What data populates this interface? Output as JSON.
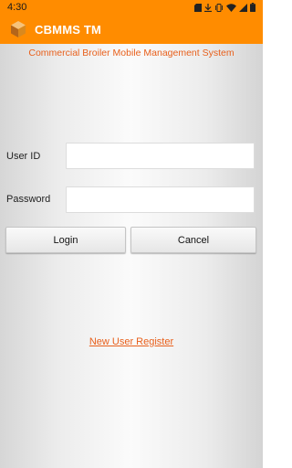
{
  "status_bar": {
    "time": "4:30",
    "icons": [
      "sim-icon",
      "download-icon",
      "vibrate-icon",
      "wifi-icon",
      "signal-icon",
      "battery-icon"
    ]
  },
  "app_bar": {
    "title": "CBMMS TM",
    "logo_icon": "cube-logo-icon",
    "color": "#ff8c00"
  },
  "subtitle": "Commercial Broiler Mobile Management System",
  "form": {
    "user_id_label": "User ID",
    "user_id_value": "",
    "password_label": "Password",
    "password_value": ""
  },
  "buttons": {
    "login_label": "Login",
    "cancel_label": "Cancel"
  },
  "register_link": "New User Register",
  "colors": {
    "accent": "#ff8c00",
    "link": "#e8601c"
  }
}
